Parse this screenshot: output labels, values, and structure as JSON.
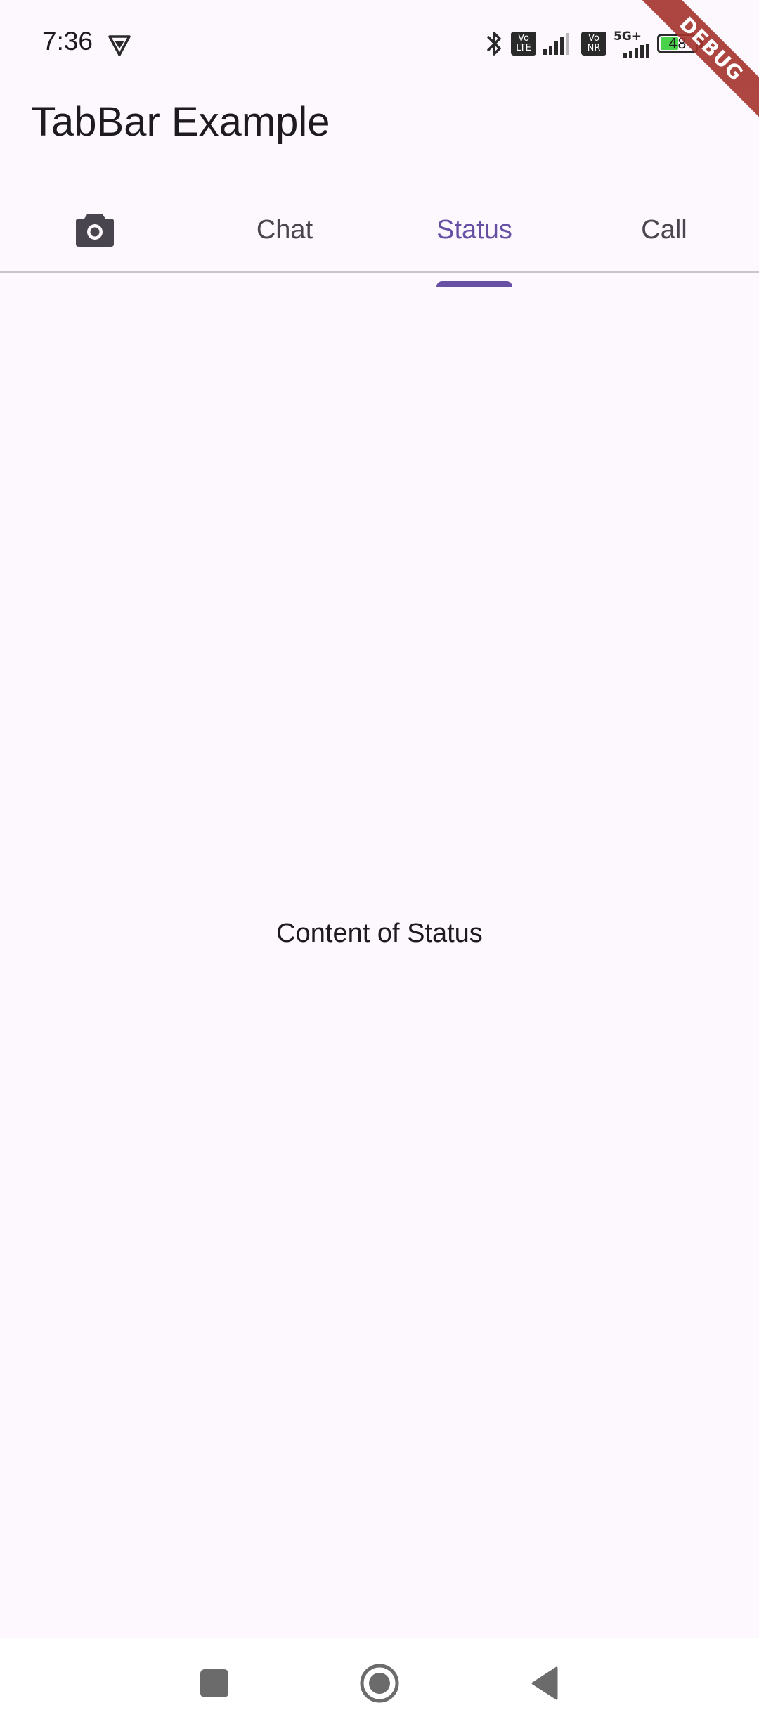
{
  "status_bar": {
    "time": "7:36",
    "network_label": "5G+",
    "volte_1": "Vo LTE",
    "volte_2": "Vo NR",
    "battery_level": "48",
    "icons": [
      "vpn-icon",
      "bluetooth-icon",
      "volte-icon",
      "signal-icon",
      "vonr-icon",
      "signal-5g-icon",
      "battery-icon"
    ]
  },
  "debug_banner": "DEBUG",
  "app_bar": {
    "title": "TabBar Example"
  },
  "tabs": [
    {
      "label": "",
      "icon": "camera-icon",
      "active": false
    },
    {
      "label": "Chat",
      "active": false
    },
    {
      "label": "Status",
      "active": true
    },
    {
      "label": "Call",
      "active": false
    }
  ],
  "content": {
    "text": "Content of Status"
  },
  "nav_bar": {
    "icons": [
      "recents-icon",
      "home-icon",
      "back-icon"
    ]
  },
  "colors": {
    "background": "#fdf7fe",
    "accent": "#6750a4",
    "inactive_tab": "#49454f",
    "debug_ribbon": "#a5332d"
  }
}
